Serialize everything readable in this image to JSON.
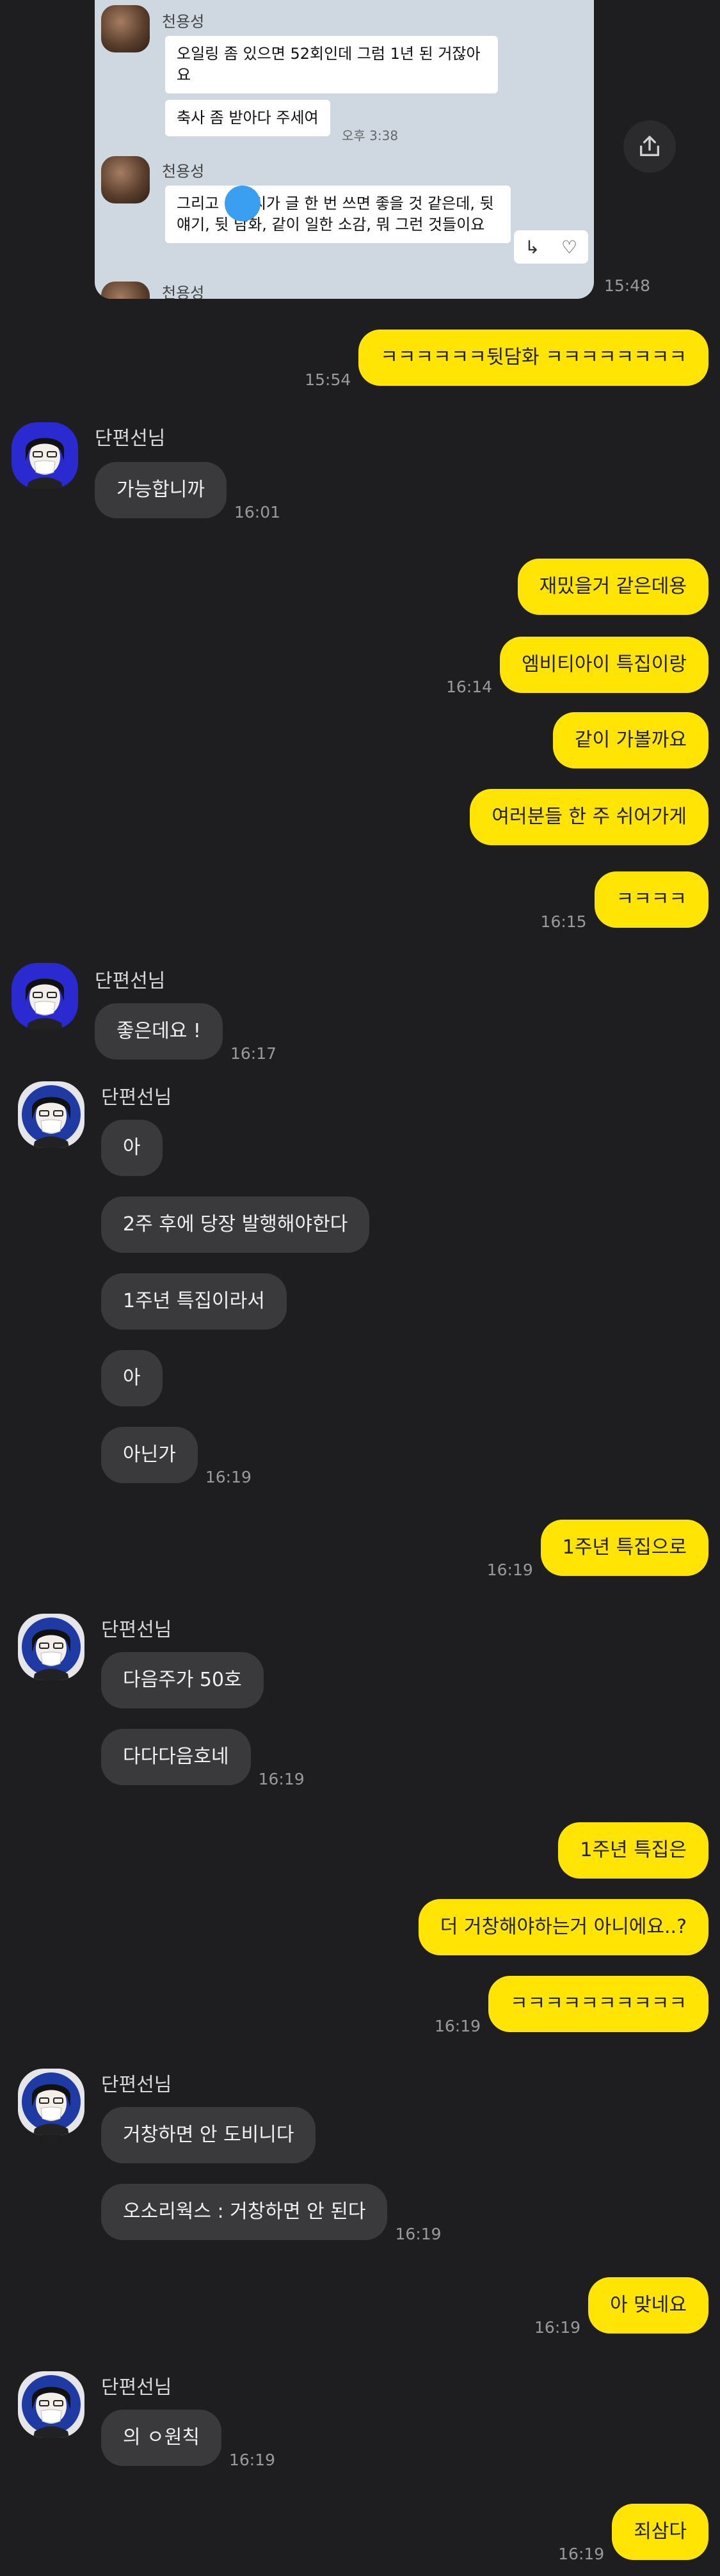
{
  "shared_card": {
    "sender1": "천용성",
    "msg1": "오일링 좀 있으면 52회인데 그럼 1년 된 거잖아요",
    "msg2": "축사 좀 받아다 주세여",
    "msg2_time": "오후 3:38",
    "sender2": "천용성",
    "msg3_a": "그리고 ",
    "msg3_b": "씨가 글 한 번 쓰면 좋을 것 같은데, 뒷 얘기, 뒷 담화, 같이 일한 소감, 뭐 그런 것들이요",
    "sender3": "천용성",
    "reply_icons": [
      "↳",
      "♡"
    ],
    "time": "15:48"
  },
  "sender_name": "단편선님",
  "messages": [
    {
      "side": "out",
      "text": "ㅋㅋㅋㅋㅋㅋ뒷담화 ㅋㅋㅋㅋㅋㅋㅋㅋ",
      "time": "15:54"
    },
    {
      "side": "in",
      "text": "가능합니까",
      "time": "16:01"
    },
    {
      "side": "out",
      "text": "재밌을거 같은데용",
      "time": ""
    },
    {
      "side": "out",
      "text": "엠비티아이 특집이랑",
      "time": "16:14"
    },
    {
      "side": "out",
      "text": "같이 가볼까요",
      "time": ""
    },
    {
      "side": "out",
      "text": "여러분들 한 주 쉬어가게",
      "time": ""
    },
    {
      "side": "out",
      "text": "ㅋㅋㅋㅋ",
      "time": "16:15"
    },
    {
      "side": "in",
      "text": "좋은데요 !",
      "time": "16:17"
    },
    {
      "side": "in",
      "text": "아",
      "time": ""
    },
    {
      "side": "in",
      "text": "2주 후에 당장 발행해야한다",
      "time": ""
    },
    {
      "side": "in",
      "text": "1주년 특집이라서",
      "time": ""
    },
    {
      "side": "in",
      "text": "아",
      "time": ""
    },
    {
      "side": "in",
      "text": "아닌가",
      "time": "16:19"
    },
    {
      "side": "out",
      "text": "1주년 특집으로",
      "time": "16:19"
    },
    {
      "side": "in",
      "text": "다음주가 50호",
      "time": ""
    },
    {
      "side": "in",
      "text": "다다다음호네",
      "time": "16:19"
    },
    {
      "side": "out",
      "text": "1주년 특집은",
      "time": ""
    },
    {
      "side": "out",
      "text": "더 거창해야하는거 아니에요..?",
      "time": ""
    },
    {
      "side": "out",
      "text": "ㅋㅋㅋㅋㅋㅋㅋㅋㅋㅋ",
      "time": "16:19"
    },
    {
      "side": "in",
      "text": "거창하면 안 도비니다",
      "time": ""
    },
    {
      "side": "in",
      "text": "오소리웍스 : 거창하면 안 된다",
      "time": "16:19"
    },
    {
      "side": "out",
      "text": "아 맞네요",
      "time": "16:19"
    },
    {
      "side": "in",
      "text": "의 ㅇ원칙",
      "time": "16:19"
    },
    {
      "side": "out",
      "text": "죄삼다",
      "time": "16:19"
    }
  ],
  "icons": {
    "share": "share-icon",
    "avatar": "profile-avatar"
  },
  "colors": {
    "background": "#1e1e20",
    "outgoing": "#ffe404",
    "incoming": "#3a3a3d",
    "card": "#cfd8e1"
  }
}
